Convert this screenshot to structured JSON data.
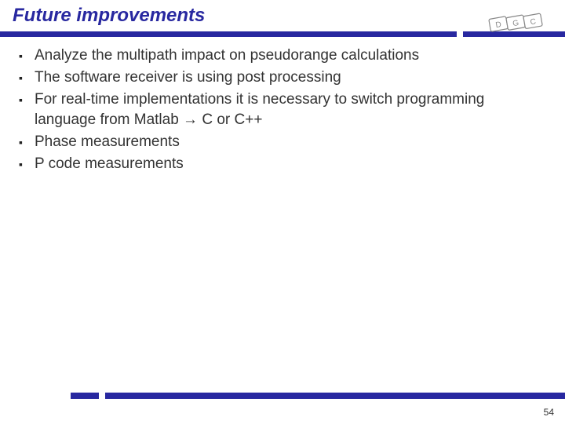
{
  "slide": {
    "title": "Future improvements",
    "bullets": [
      "Analyze the multipath impact on pseudorange calculations",
      "The software receiver is using post processing",
      "For real-time implementations it is necessary to switch programming language from Matlab → C or C++",
      "Phase measurements",
      "P code measurements"
    ],
    "page_number": "54",
    "logo_label": "DGC"
  }
}
